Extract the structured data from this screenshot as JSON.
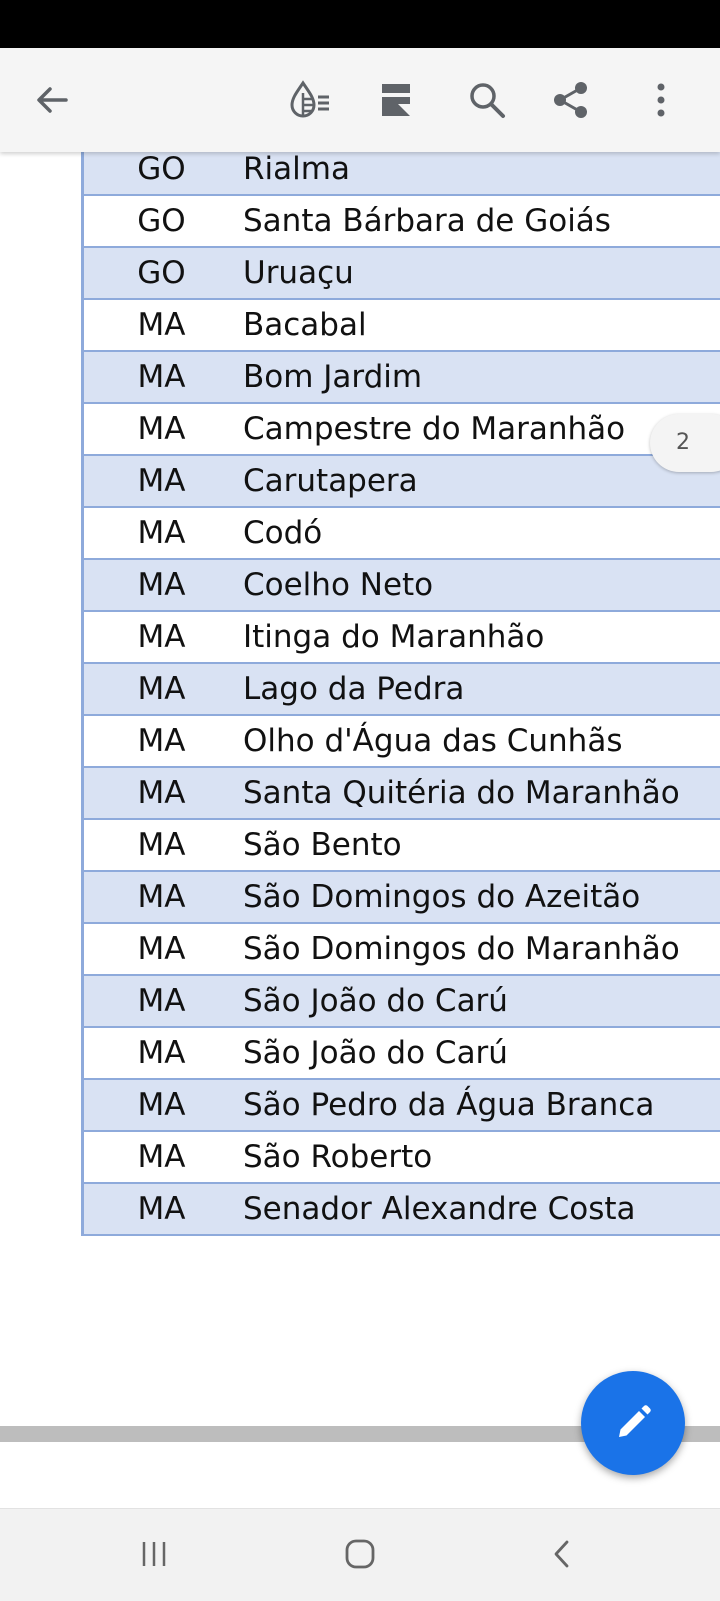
{
  "toolbar": {
    "back_icon": "arrow-back-icon",
    "ink_icon": "ink-drop-icon",
    "layout_icon": "reading-mode-icon",
    "search_icon": "search-icon",
    "share_icon": "share-icon",
    "more_icon": "more-vert-icon"
  },
  "table": {
    "rows": [
      {
        "uf": "GO",
        "city": "Rialma"
      },
      {
        "uf": "GO",
        "city": "Santa Bárbara de Goiás"
      },
      {
        "uf": "GO",
        "city": "Uruaçu"
      },
      {
        "uf": "MA",
        "city": "Bacabal"
      },
      {
        "uf": "MA",
        "city": "Bom Jardim"
      },
      {
        "uf": "MA",
        "city": "Campestre do Maranhão"
      },
      {
        "uf": "MA",
        "city": "Carutapera"
      },
      {
        "uf": "MA",
        "city": "Codó"
      },
      {
        "uf": "MA",
        "city": "Coelho Neto"
      },
      {
        "uf": "MA",
        "city": "Itinga do Maranhão"
      },
      {
        "uf": "MA",
        "city": "Lago da Pedra"
      },
      {
        "uf": "MA",
        "city": "Olho d'Água das Cunhãs"
      },
      {
        "uf": "MA",
        "city": "Santa Quitéria do Maranhão"
      },
      {
        "uf": "MA",
        "city": "São Bento"
      },
      {
        "uf": "MA",
        "city": "São Domingos do Azeitão"
      },
      {
        "uf": "MA",
        "city": "São Domingos do Maranhão"
      },
      {
        "uf": "MA",
        "city": "São João do Carú"
      },
      {
        "uf": "MA",
        "city": "São João do Carú"
      },
      {
        "uf": "MA",
        "city": "São Pedro da Água Branca"
      },
      {
        "uf": "MA",
        "city": "São Roberto"
      },
      {
        "uf": "MA",
        "city": "Senador Alexandre Costa"
      }
    ]
  },
  "page_indicator": "2",
  "fab": {
    "icon": "edit-pencil-icon"
  },
  "nav": {
    "recents_icon": "recent-apps-icon",
    "home_icon": "home-icon",
    "back_icon": "nav-back-icon"
  },
  "colors": {
    "row_shade": "#d9e2f3",
    "table_border": "#8eaadb",
    "fab": "#1a73e8"
  }
}
